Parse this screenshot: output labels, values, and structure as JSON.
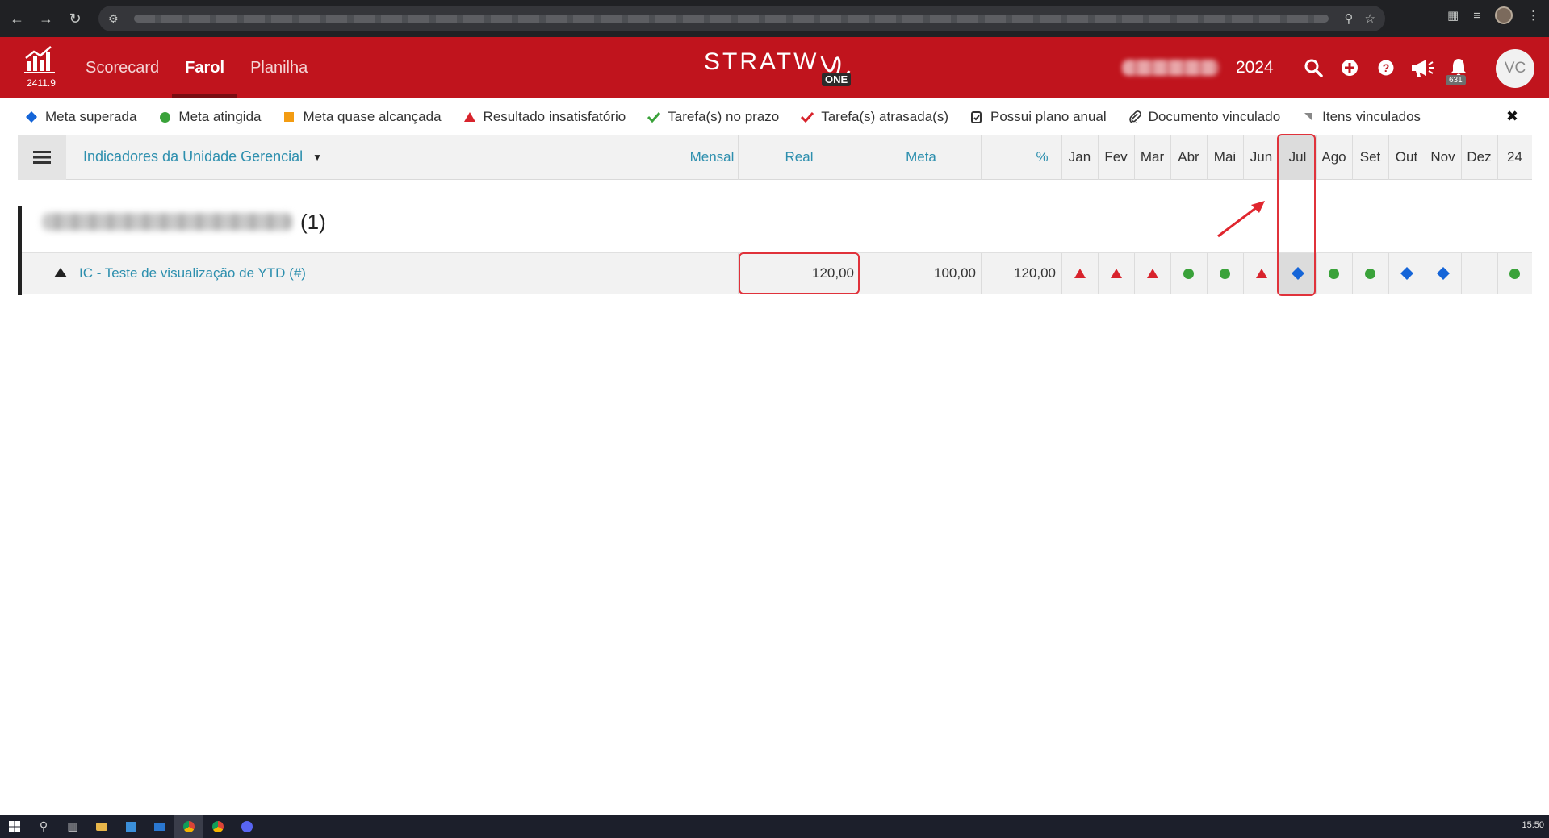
{
  "app": {
    "version": "2411.9",
    "nav_tabs": [
      {
        "label": "Scorecard",
        "active": false
      },
      {
        "label": "Farol",
        "active": true
      },
      {
        "label": "Planilha",
        "active": false
      }
    ],
    "brand": "STRATW",
    "brand_suffix": "ONE",
    "year": "2024",
    "notifications_count": "631",
    "avatar_initials": "VC",
    "colors": {
      "header": "#c0141d",
      "link": "#2d8fae",
      "blue": "#1565d8",
      "green": "#3aa23a",
      "orange": "#f39c12",
      "red": "#d8232c"
    }
  },
  "legend": [
    {
      "symbol": "diamond-blue",
      "label": "Meta superada"
    },
    {
      "symbol": "circle-green",
      "label": "Meta atingida"
    },
    {
      "symbol": "square-orange",
      "label": "Meta quase alcançada"
    },
    {
      "symbol": "triangle-red",
      "label": "Resultado insatisfatório"
    },
    {
      "symbol": "check-green",
      "label": "Tarefa(s) no prazo"
    },
    {
      "symbol": "check-red",
      "label": "Tarefa(s) atrasada(s)"
    },
    {
      "symbol": "annual-plan-icon",
      "label": "Possui plano anual"
    },
    {
      "symbol": "paperclip-icon",
      "label": "Documento vinculado"
    },
    {
      "symbol": "corner-icon",
      "label": "Itens vinculados"
    }
  ],
  "table": {
    "title": "Indicadores da Unidade Gerencial",
    "period": "Mensal",
    "col_real": "Real",
    "col_meta": "Meta",
    "col_pct": "%",
    "months": [
      "Jan",
      "Fev",
      "Mar",
      "Abr",
      "Mai",
      "Jun",
      "Jul",
      "Ago",
      "Set",
      "Out",
      "Nov",
      "Dez"
    ],
    "year_col": "24",
    "highlighted_month": "Jul",
    "group": {
      "count": "(1)"
    },
    "rows": [
      {
        "name": "IC - Teste de visualização de YTD (#)",
        "real": "120,00",
        "meta": "100,00",
        "pct": "120,00",
        "months": [
          "triangle-red",
          "triangle-red",
          "triangle-red",
          "circle-green",
          "circle-green",
          "triangle-red",
          "diamond-blue",
          "circle-green",
          "circle-green",
          "diamond-blue",
          "diamond-blue",
          ""
        ],
        "year": "circle-green"
      }
    ]
  },
  "taskbar": {
    "clock": "15:50"
  }
}
